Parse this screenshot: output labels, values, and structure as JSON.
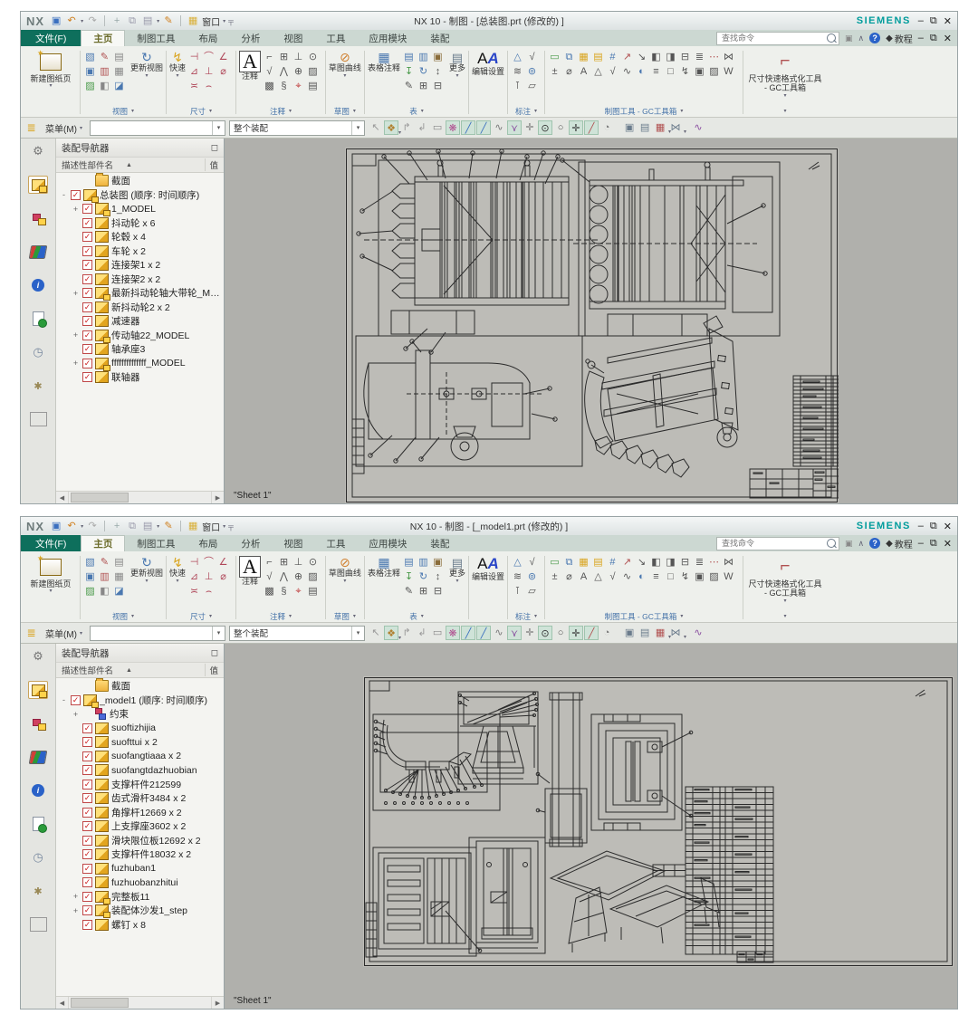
{
  "shared": {
    "brand": "NX",
    "siemens": "SIEMENS",
    "window_menu": "窗口",
    "file_tab": "文件(F)",
    "active_tab": "主页",
    "tabs": [
      "主页",
      "制图工具",
      "布局",
      "分析",
      "视图",
      "工具",
      "应用模块",
      "装配"
    ],
    "search_placeholder": "查找命令",
    "tutorial": "教程",
    "ribbon": {
      "new_sheet": "新建图纸页",
      "update_views": "更新视图",
      "rapid": "快速",
      "note": "注释",
      "sketch_curve": "草图曲线",
      "table_note": "表格注释",
      "more": "更多",
      "edit_settings": "编辑设置",
      "dim_quick_tool": "尺寸快速格式化工具 - GC工具箱",
      "group_view": "视图",
      "group_dimension": "尺寸",
      "group_annotation": "注释",
      "group_sketch": "草图",
      "group_table": "表",
      "group_callout": "标注",
      "group_gc": "制图工具 - GC工具箱",
      "view_icons": [
        {
          "name": "view-wizard-icon",
          "g": "▧",
          "c": "#4a78b0"
        },
        {
          "name": "edit-view-icon",
          "g": "✎",
          "c": "#b05050"
        },
        {
          "name": "printer-icon",
          "g": "▤",
          "c": "#888888"
        },
        {
          "name": "view-boundary-icon",
          "g": "▣",
          "c": "#4a78b0"
        },
        {
          "name": "display-options-icon",
          "g": "▥",
          "c": "#b05050"
        },
        {
          "name": "film-icon",
          "g": "▦",
          "c": "#888888"
        },
        {
          "name": "image-view-icon",
          "g": "▨",
          "c": "#4a9a4a"
        },
        {
          "name": "break-view-icon",
          "g": "◧",
          "c": "#888888"
        },
        {
          "name": "section-line-icon",
          "g": "◪",
          "c": "#4a78b0"
        }
      ],
      "dim_icons": [
        {
          "name": "linear-dimension-icon",
          "g": "⊣",
          "c": "#b0485a"
        },
        {
          "name": "radial-dimension-icon",
          "g": "⌒",
          "c": "#b0485a"
        },
        {
          "name": "angular-dimension-icon",
          "g": "∠",
          "c": "#b0485a"
        },
        {
          "name": "chamfer-dimension-icon",
          "g": "⊿",
          "c": "#b0485a"
        },
        {
          "name": "ordinate-dimension-icon",
          "g": "⊥",
          "c": "#b0485a"
        },
        {
          "name": "hole-dimension-icon",
          "g": "⌀",
          "c": "#b0485a"
        },
        {
          "name": "thickness-dimension-icon",
          "g": "≍",
          "c": "#b0485a"
        },
        {
          "name": "arc-length-dimension-icon",
          "g": "⌢",
          "c": "#b0485a"
        }
      ],
      "anno_icons": [
        {
          "name": "leader-icon",
          "g": "⌐",
          "c": "#555555"
        },
        {
          "name": "fcf-icon",
          "g": "⊞",
          "c": "#555555"
        },
        {
          "name": "datum-feature-icon",
          "g": "⊥",
          "c": "#555555"
        },
        {
          "name": "balloon-icon",
          "g": "⊙",
          "c": "#555555"
        },
        {
          "name": "surface-finish-icon",
          "g": "√",
          "c": "#555555"
        },
        {
          "name": "weld-symbol-icon",
          "g": "⋀",
          "c": "#555555"
        },
        {
          "name": "target-point-icon",
          "g": "⊕",
          "c": "#555555"
        },
        {
          "name": "crosshatch-icon",
          "g": "▨",
          "c": "#555555"
        },
        {
          "name": "area-fill-icon",
          "g": "▩",
          "c": "#555555"
        },
        {
          "name": "custom-symbol-icon",
          "g": "§",
          "c": "#555555"
        },
        {
          "name": "centerline-icon",
          "g": "⌖",
          "c": "#c04040"
        },
        {
          "name": "image-note-icon",
          "g": "▤",
          "c": "#555555"
        }
      ],
      "table_icons": [
        {
          "name": "parts-list-icon",
          "g": "▤",
          "c": "#4a78b0"
        },
        {
          "name": "hole-table-icon",
          "g": "▥",
          "c": "#4a78b0"
        },
        {
          "name": "cell-settings-icon",
          "g": "▣",
          "c": "#8a6d3b"
        },
        {
          "name": "import-spreadsheet-icon",
          "g": "↧",
          "c": "#4a9a4a"
        },
        {
          "name": "update-parts-list-icon",
          "g": "↻",
          "c": "#4a78b0"
        },
        {
          "name": "sort-table-icon",
          "g": "↕",
          "c": "#555555"
        },
        {
          "name": "edit-text-icon",
          "g": "✎",
          "c": "#555555"
        },
        {
          "name": "merge-cells-icon",
          "g": "⊞",
          "c": "#555555"
        },
        {
          "name": "split-cells-icon",
          "g": "⊟",
          "c": "#555555"
        }
      ],
      "callout_icons": [
        {
          "name": "symbol-mark-icon",
          "g": "△",
          "c": "#4a78b0"
        },
        {
          "name": "roughness-icon",
          "g": "√",
          "c": "#555555"
        },
        {
          "name": "weld-mark-icon",
          "g": "≋",
          "c": "#555555"
        },
        {
          "name": "balloon-mark-icon",
          "g": "⊚",
          "c": "#4a78b0"
        },
        {
          "name": "datum-mark-icon",
          "g": "⊺",
          "c": "#555555"
        },
        {
          "name": "stamp-icon",
          "g": "▱",
          "c": "#555555"
        }
      ],
      "gc_icons": [
        {
          "name": "drawing-frame-icon",
          "g": "▭",
          "c": "#4a9a4a"
        },
        {
          "name": "replace-template-icon",
          "g": "⧉",
          "c": "#4a78b0"
        },
        {
          "name": "title-block-icon",
          "g": "▦",
          "c": "#d9a520"
        },
        {
          "name": "parts-list-gc-icon",
          "g": "▤",
          "c": "#d9a520"
        },
        {
          "name": "auto-balloon-icon",
          "g": "#",
          "c": "#4a78b0"
        },
        {
          "name": "export-sheet-icon",
          "g": "↗",
          "c": "#b05050"
        },
        {
          "name": "bom-export-icon",
          "g": "↘",
          "c": "#555555"
        },
        {
          "name": "window-cascade-icon",
          "g": "◧",
          "c": "#555555"
        },
        {
          "name": "window-tile-icon",
          "g": "◨",
          "c": "#555555"
        },
        {
          "name": "window-split-icon",
          "g": "⊟",
          "c": "#555555"
        },
        {
          "name": "align-dimensions-icon",
          "g": "≣",
          "c": "#555555"
        },
        {
          "name": "consecutive-dimension-icon",
          "g": "⋯",
          "c": "#b05050"
        },
        {
          "name": "symmetric-dimension-icon",
          "g": "⋈",
          "c": "#555555"
        },
        {
          "name": "tolerance-icon",
          "g": "±",
          "c": "#555555"
        },
        {
          "name": "fit-tolerance-icon",
          "g": "⌀",
          "c": "#555555"
        },
        {
          "name": "abc-annotation-icon",
          "g": "A",
          "c": "#555555"
        },
        {
          "name": "angle-gc-icon",
          "g": "△",
          "c": "#555555"
        },
        {
          "name": "roughness-gc-icon",
          "g": "√",
          "c": "#555555"
        },
        {
          "name": "wave-symbol-icon",
          "g": "∿",
          "c": "#555555"
        },
        {
          "name": "sphere-view-icon",
          "g": "◐",
          "c": "#4a78b0"
        },
        {
          "name": "coordinate-icon",
          "g": "≡",
          "c": "#555555"
        },
        {
          "name": "box-select-icon",
          "g": "□",
          "c": "#555555"
        },
        {
          "name": "electric-symbol-icon",
          "g": "↯",
          "c": "#555555"
        },
        {
          "name": "image-gc-icon",
          "g": "▣",
          "c": "#555555"
        },
        {
          "name": "hatch-gc-icon",
          "g": "▨",
          "c": "#555555"
        },
        {
          "name": "weld-table-icon",
          "g": "W",
          "c": "#555555"
        }
      ]
    },
    "toolbar": {
      "menu": "菜单(M)",
      "scope": "整个装配",
      "icons": [
        {
          "name": "pan-back-icon",
          "g": "↖",
          "c": "#999999"
        },
        {
          "name": "snap-settings-icon",
          "g": "❖",
          "c": "#b08030",
          "hl": true,
          "dd": true
        },
        {
          "name": "move-forward-icon",
          "g": "↱",
          "c": "#999999"
        },
        {
          "name": "move-back-icon",
          "g": "↲",
          "c": "#999999"
        },
        {
          "name": "rectangle-select-icon",
          "g": "▭",
          "c": "#888888",
          "dd": true
        },
        {
          "name": "snap-point-toggle-icon",
          "g": "❋",
          "c": "#b05090",
          "hl": true
        },
        {
          "name": "endpoint-snap-icon",
          "g": "╱",
          "c": "#3a6fbf",
          "hl": true
        },
        {
          "name": "midpoint-snap-icon",
          "g": "╱",
          "c": "#3a6fbf",
          "hl": true
        },
        {
          "name": "curve-snap-icon",
          "g": "∿",
          "c": "#777777"
        },
        {
          "name": "vertex-snap-icon",
          "g": "⋎",
          "c": "#8a4fa0",
          "hl": true
        },
        {
          "name": "cross-snap-icon",
          "g": "✛",
          "c": "#777777"
        },
        {
          "name": "center-snap-icon",
          "g": "⊙",
          "c": "#333333",
          "hl": true
        },
        {
          "name": "circle-snap-icon",
          "g": "○",
          "c": "#555555"
        },
        {
          "name": "plus-snap-icon",
          "g": "✛",
          "c": "#333333",
          "hl": true
        },
        {
          "name": "angle-snap-icon",
          "g": "╱",
          "c": "#b05050",
          "hl": true
        },
        {
          "name": "quadrant-snap-icon",
          "g": "◔",
          "c": "#777777"
        },
        {
          "name": "shaded-view-icon",
          "g": "▣",
          "c": "#6b7c8c",
          "sep": true
        },
        {
          "name": "wireframe-view-icon",
          "g": "▤",
          "c": "#6b7c8c"
        },
        {
          "name": "grid-display-icon",
          "g": "▦",
          "c": "#b05050",
          "dd": true
        },
        {
          "name": "style-dropdown-icon",
          "g": "⋈",
          "c": "#6b7c8c",
          "dd": true
        },
        {
          "name": "spline-tool-icon",
          "g": "∿",
          "c": "#8a4fa0",
          "sep": true
        }
      ]
    },
    "navigator": {
      "title": "装配导航器",
      "name_col": "描述性部件名",
      "value_col": "值"
    },
    "sheet_tab": "\"Sheet 1\""
  },
  "windows": [
    {
      "title": "NX 10 - 制图 - [总装图.prt (修改的) ]",
      "tree": [
        {
          "ind": 1,
          "exp": "",
          "chk": false,
          "icon": "folder",
          "label": "截面"
        },
        {
          "ind": 0,
          "exp": "-",
          "chk": true,
          "icon": "assembly",
          "label": "总装图 (顺序: 时间顺序)"
        },
        {
          "ind": 1,
          "exp": "+",
          "chk": true,
          "icon": "assembly",
          "label": "1_MODEL"
        },
        {
          "ind": 1,
          "exp": "",
          "chk": true,
          "icon": "part",
          "label": "抖动轮 x 6"
        },
        {
          "ind": 1,
          "exp": "",
          "chk": true,
          "icon": "part",
          "label": "轮毂 x 4"
        },
        {
          "ind": 1,
          "exp": "",
          "chk": true,
          "icon": "part",
          "label": "车轮 x 2"
        },
        {
          "ind": 1,
          "exp": "",
          "chk": true,
          "icon": "part",
          "label": "连接架1 x 2"
        },
        {
          "ind": 1,
          "exp": "",
          "chk": true,
          "icon": "part",
          "label": "连接架2 x 2"
        },
        {
          "ind": 1,
          "exp": "+",
          "chk": true,
          "icon": "assembly",
          "label": "最新抖动轮轴大带轮_MOD..."
        },
        {
          "ind": 1,
          "exp": "",
          "chk": true,
          "icon": "part",
          "label": "新抖动轮2 x 2"
        },
        {
          "ind": 1,
          "exp": "",
          "chk": true,
          "icon": "part",
          "label": "减速器"
        },
        {
          "ind": 1,
          "exp": "+",
          "chk": true,
          "icon": "assembly",
          "label": "传动轴22_MODEL"
        },
        {
          "ind": 1,
          "exp": "",
          "chk": true,
          "icon": "part",
          "label": "轴承座3"
        },
        {
          "ind": 1,
          "exp": "+",
          "chk": true,
          "icon": "assembly",
          "label": "ffffffffffffff_MODEL"
        },
        {
          "ind": 1,
          "exp": "",
          "chk": true,
          "icon": "part",
          "label": "联轴器"
        }
      ]
    },
    {
      "title": "NX 10 - 制图 - [_model1.prt (修改的) ]",
      "tree": [
        {
          "ind": 1,
          "exp": "",
          "chk": false,
          "icon": "folder",
          "label": "截面"
        },
        {
          "ind": 0,
          "exp": "-",
          "chk": true,
          "icon": "assembly",
          "label": "_model1 (顺序: 时间顺序)"
        },
        {
          "ind": 1,
          "exp": "+",
          "chk": false,
          "icon": "constraint",
          "label": "约束"
        },
        {
          "ind": 1,
          "exp": "",
          "chk": true,
          "icon": "part",
          "label": "suoftizhijia"
        },
        {
          "ind": 1,
          "exp": "",
          "chk": true,
          "icon": "part",
          "label": "suofttui x 2"
        },
        {
          "ind": 1,
          "exp": "",
          "chk": true,
          "icon": "part",
          "label": "suofangtiaaa x 2"
        },
        {
          "ind": 1,
          "exp": "",
          "chk": true,
          "icon": "part",
          "label": "suofangtdazhuobian"
        },
        {
          "ind": 1,
          "exp": "",
          "chk": true,
          "icon": "part",
          "label": "支撑杆件212599"
        },
        {
          "ind": 1,
          "exp": "",
          "chk": true,
          "icon": "part",
          "label": "齿式滑杆3484 x 2"
        },
        {
          "ind": 1,
          "exp": "",
          "chk": true,
          "icon": "part",
          "label": "角撑杆12669 x 2"
        },
        {
          "ind": 1,
          "exp": "",
          "chk": true,
          "icon": "part",
          "label": "上支撑座3602 x 2"
        },
        {
          "ind": 1,
          "exp": "",
          "chk": true,
          "icon": "part",
          "label": "滑块限位板12692 x 2"
        },
        {
          "ind": 1,
          "exp": "",
          "chk": true,
          "icon": "part",
          "label": "支撑杆件18032 x 2"
        },
        {
          "ind": 1,
          "exp": "",
          "chk": true,
          "icon": "part",
          "label": "fuzhuban1"
        },
        {
          "ind": 1,
          "exp": "",
          "chk": true,
          "icon": "part",
          "label": "fuzhuobanzhitui"
        },
        {
          "ind": 1,
          "exp": "+",
          "chk": true,
          "icon": "assembly",
          "label": "完整板11"
        },
        {
          "ind": 1,
          "exp": "+",
          "chk": true,
          "icon": "assembly",
          "label": "装配体沙发1_step"
        },
        {
          "ind": 1,
          "exp": "",
          "chk": true,
          "icon": "part",
          "label": "螺钉 x 8"
        }
      ]
    }
  ]
}
